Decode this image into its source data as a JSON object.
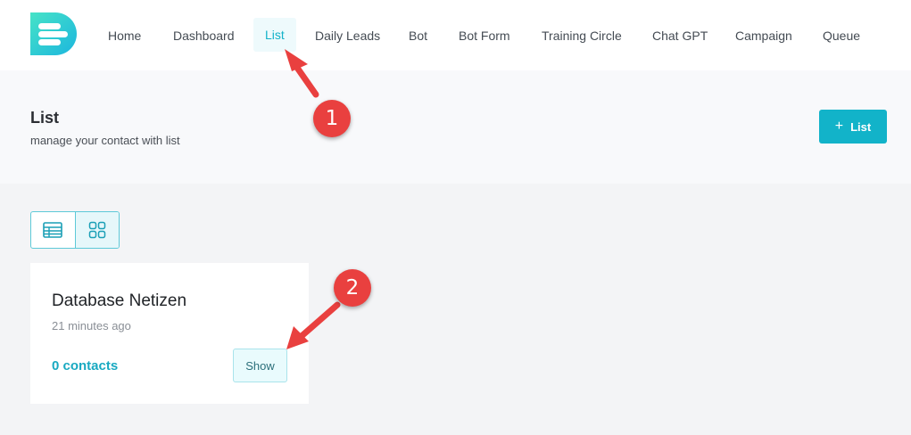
{
  "nav": {
    "logo": "logo-icon",
    "items": [
      {
        "label": "Home"
      },
      {
        "label": "Dashboard"
      },
      {
        "label": "List"
      },
      {
        "label": "Daily Leads"
      },
      {
        "label": "Bot"
      },
      {
        "label": "Bot Form"
      },
      {
        "label": "Training Circle"
      },
      {
        "label": "Chat GPT"
      },
      {
        "label": "Campaign"
      },
      {
        "label": "Queue"
      }
    ],
    "active": "List"
  },
  "header": {
    "title": "List",
    "subtitle": "manage your contact with list",
    "add_button": {
      "icon": "plus-icon",
      "label": "List"
    }
  },
  "view_toggle": {
    "options": [
      "table-view-icon",
      "grid-view-icon"
    ],
    "active": "grid-view-icon"
  },
  "lists": [
    {
      "name": "Database Netizen",
      "time": "21 minutes ago",
      "contacts": "0 contacts",
      "show_label": "Show"
    }
  ],
  "annotations": [
    {
      "number": "1"
    },
    {
      "number": "2"
    }
  ],
  "colors": {
    "accent": "#12b3c9",
    "annotation": "#e9403f",
    "page_bg": "#f3f4f6"
  }
}
